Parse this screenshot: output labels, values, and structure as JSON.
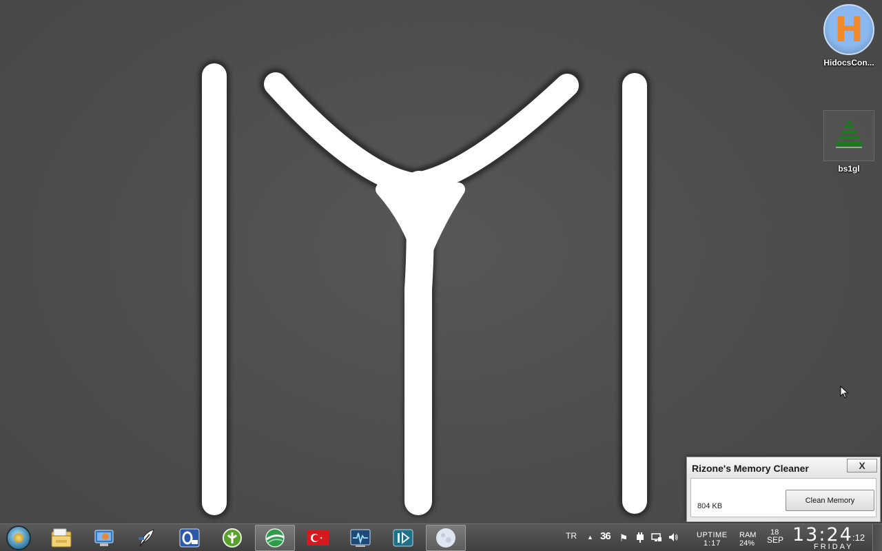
{
  "desktop": {
    "icons": [
      {
        "label": "HidocsCon...",
        "glyph": "H",
        "icon": "hidocs-app-icon"
      },
      {
        "label": "bs1gl",
        "icon": "green-stacked-tree-icon"
      }
    ]
  },
  "memory_cleaner": {
    "title": "Rizone's Memory Cleaner",
    "close_glyph": "X",
    "usage": "804 KB",
    "clean_button": "Clean Memory"
  },
  "taskbar": {
    "items": [
      {
        "icon": "start-orb-icon"
      },
      {
        "icon": "file-explorer-icon"
      },
      {
        "icon": "remote-desktop-icon"
      },
      {
        "icon": "feather-pen-icon"
      },
      {
        "icon": "opera-mail-icon"
      },
      {
        "icon": "green-circle-app-icon"
      },
      {
        "icon": "green-globe-app-icon",
        "active": true
      },
      {
        "icon": "turkey-flag-icon"
      },
      {
        "icon": "system-monitor-icon"
      },
      {
        "icon": "teal-media-app-icon"
      },
      {
        "icon": "moon-app-icon",
        "active": true
      }
    ],
    "tray": {
      "language": "TR",
      "up_arrow": "▲",
      "number": "36",
      "uptime_label": "UPTIME",
      "uptime_value": "1:17",
      "ram_label": "RAM",
      "ram_value": "24%",
      "date_day": "18",
      "date_month": "SEP",
      "clock_time": "13:24",
      "clock_seconds": ":12",
      "clock_weekday": "FRIDAY"
    }
  },
  "colors": {
    "desktop_bg": "#4e4e4e",
    "logo_fill": "#ffffff",
    "hidocs_bg": "#8bb8ef",
    "hidocs_letter": "#f28a2a",
    "tree_green": "#1e7a1e"
  }
}
